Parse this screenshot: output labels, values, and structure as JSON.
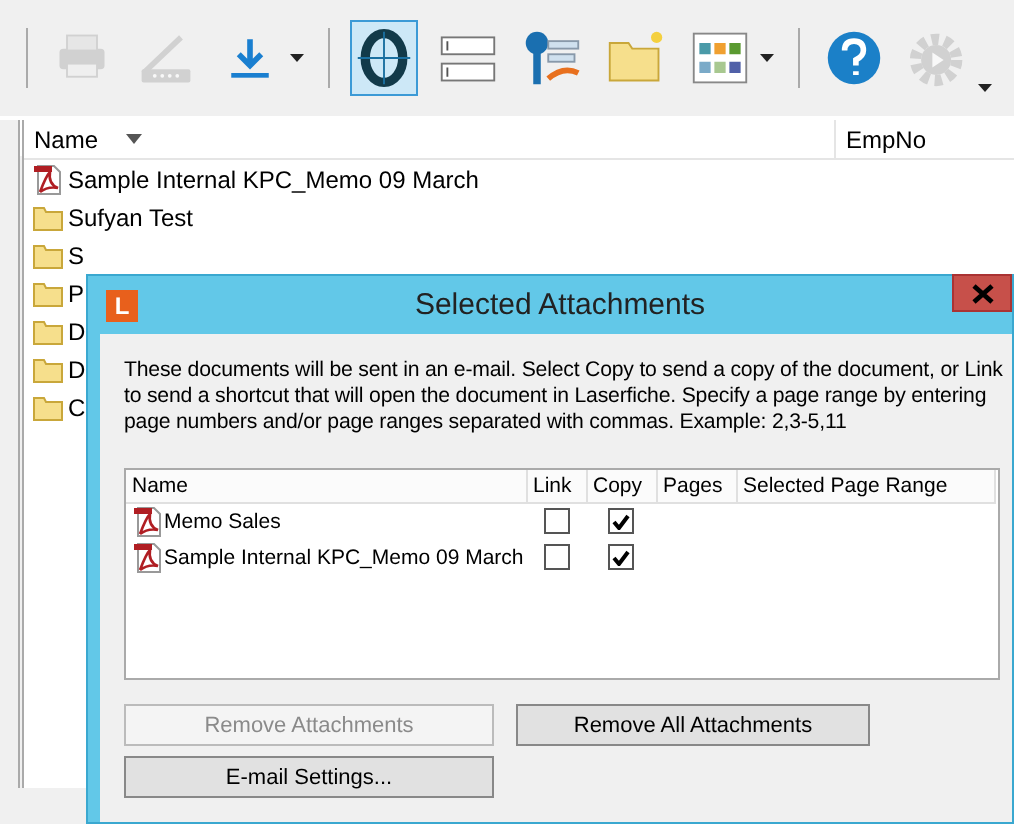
{
  "toolbar": [
    {
      "kind": "printer",
      "disabled": true,
      "selected": false,
      "dropdown": false
    },
    {
      "kind": "scanner",
      "disabled": true,
      "selected": false,
      "dropdown": false
    },
    {
      "kind": "download",
      "disabled": false,
      "selected": false,
      "dropdown": true
    },
    {
      "kind": "ocr",
      "disabled": false,
      "selected": true,
      "dropdown": false
    },
    {
      "kind": "fields",
      "disabled": false,
      "selected": false,
      "dropdown": false
    },
    {
      "kind": "key",
      "disabled": false,
      "selected": false,
      "dropdown": false
    },
    {
      "kind": "new-folder",
      "disabled": false,
      "selected": false,
      "dropdown": false
    },
    {
      "kind": "grid",
      "disabled": false,
      "selected": false,
      "dropdown": true
    },
    {
      "kind": "help",
      "disabled": false,
      "selected": false,
      "dropdown": false
    },
    {
      "kind": "gear",
      "disabled": true,
      "selected": false,
      "dropdown": true
    }
  ],
  "file_list": {
    "columns": [
      {
        "label": "Name",
        "sorted": true
      },
      {
        "label": "EmpNo",
        "sorted": false
      }
    ],
    "rows": [
      {
        "kind": "pdf",
        "name": "Sample Internal KPC_Memo 09 March"
      },
      {
        "kind": "folder",
        "name": "Sufyan Test"
      },
      {
        "kind": "folder",
        "name": "S"
      },
      {
        "kind": "folder",
        "name": "P"
      },
      {
        "kind": "folder",
        "name": "D"
      },
      {
        "kind": "folder",
        "name": "D"
      },
      {
        "kind": "folder",
        "name": "C"
      }
    ]
  },
  "dialog": {
    "title": "Selected Attachments",
    "app_badge": "L",
    "description": "These documents will be sent in an e-mail. Select Copy to send a copy of the document, or Link to send a shortcut that will open the document in Laserfiche.  Specify a page range by entering page numbers and/or page ranges separated with commas.  Example: 2,3-5,11",
    "columns": [
      "Name",
      "Link",
      "Copy",
      "Pages",
      "Selected Page Range"
    ],
    "attachments": [
      {
        "name": "Memo Sales",
        "link": false,
        "copy": true
      },
      {
        "name": "Sample Internal KPC_Memo 09 March",
        "link": false,
        "copy": true
      }
    ],
    "buttons": [
      {
        "label": "Remove Attachments",
        "disabled": true
      },
      {
        "label": "Remove All Attachments",
        "disabled": false
      },
      {
        "label": "E-mail Settings...",
        "disabled": false
      }
    ]
  }
}
